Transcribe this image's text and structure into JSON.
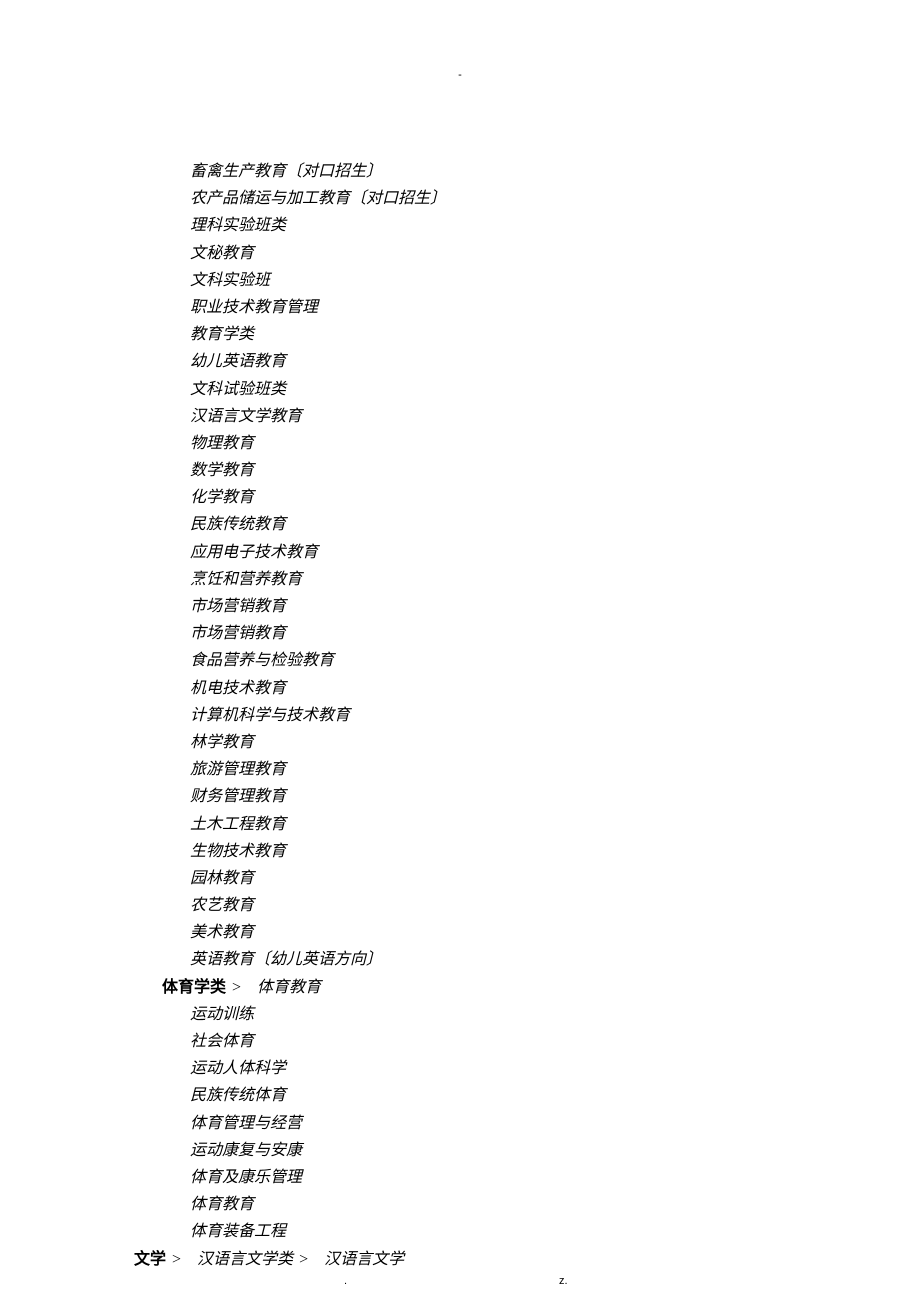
{
  "header_mark": "-",
  "education_items": [
    "畜禽生产教育〔对口招生〕",
    "农产品储运与加工教育〔对口招生〕",
    "理科实验班类",
    "文秘教育",
    "文科实验班",
    "职业技术教育管理",
    "教育学类",
    "幼儿英语教育",
    "文科试验班类",
    "汉语言文学教育",
    "物理教育",
    "数学教育",
    "化学教育",
    "民族传统教育",
    "应用电子技术教育",
    "烹饪和营养教育",
    "市场营销教育",
    "市场营销教育",
    "食品营养与检验教育",
    "机电技术教育",
    "计算机科学与技术教育",
    "林学教育",
    "旅游管理教育",
    "财务管理教育",
    "土木工程教育",
    "生物技术教育",
    "园林教育",
    "农艺教育",
    "美术教育",
    "英语教育〔幼儿英语方向〕"
  ],
  "pe_category": {
    "label": "体育学类",
    "sep": ">",
    "first": "体育教育"
  },
  "pe_items": [
    "运动训练",
    "社会体育",
    "运动人体科学",
    "民族传统体育",
    "体育管理与经营",
    "运动康复与安康",
    "体育及康乐管理",
    "体育教育",
    "体育装备工程"
  ],
  "lit_line": {
    "label1": "文学",
    "sep": ">",
    "label2": "汉语言文学类",
    "label3": "汉语言文学"
  },
  "footer": {
    "dot": ".",
    "z": "z."
  }
}
